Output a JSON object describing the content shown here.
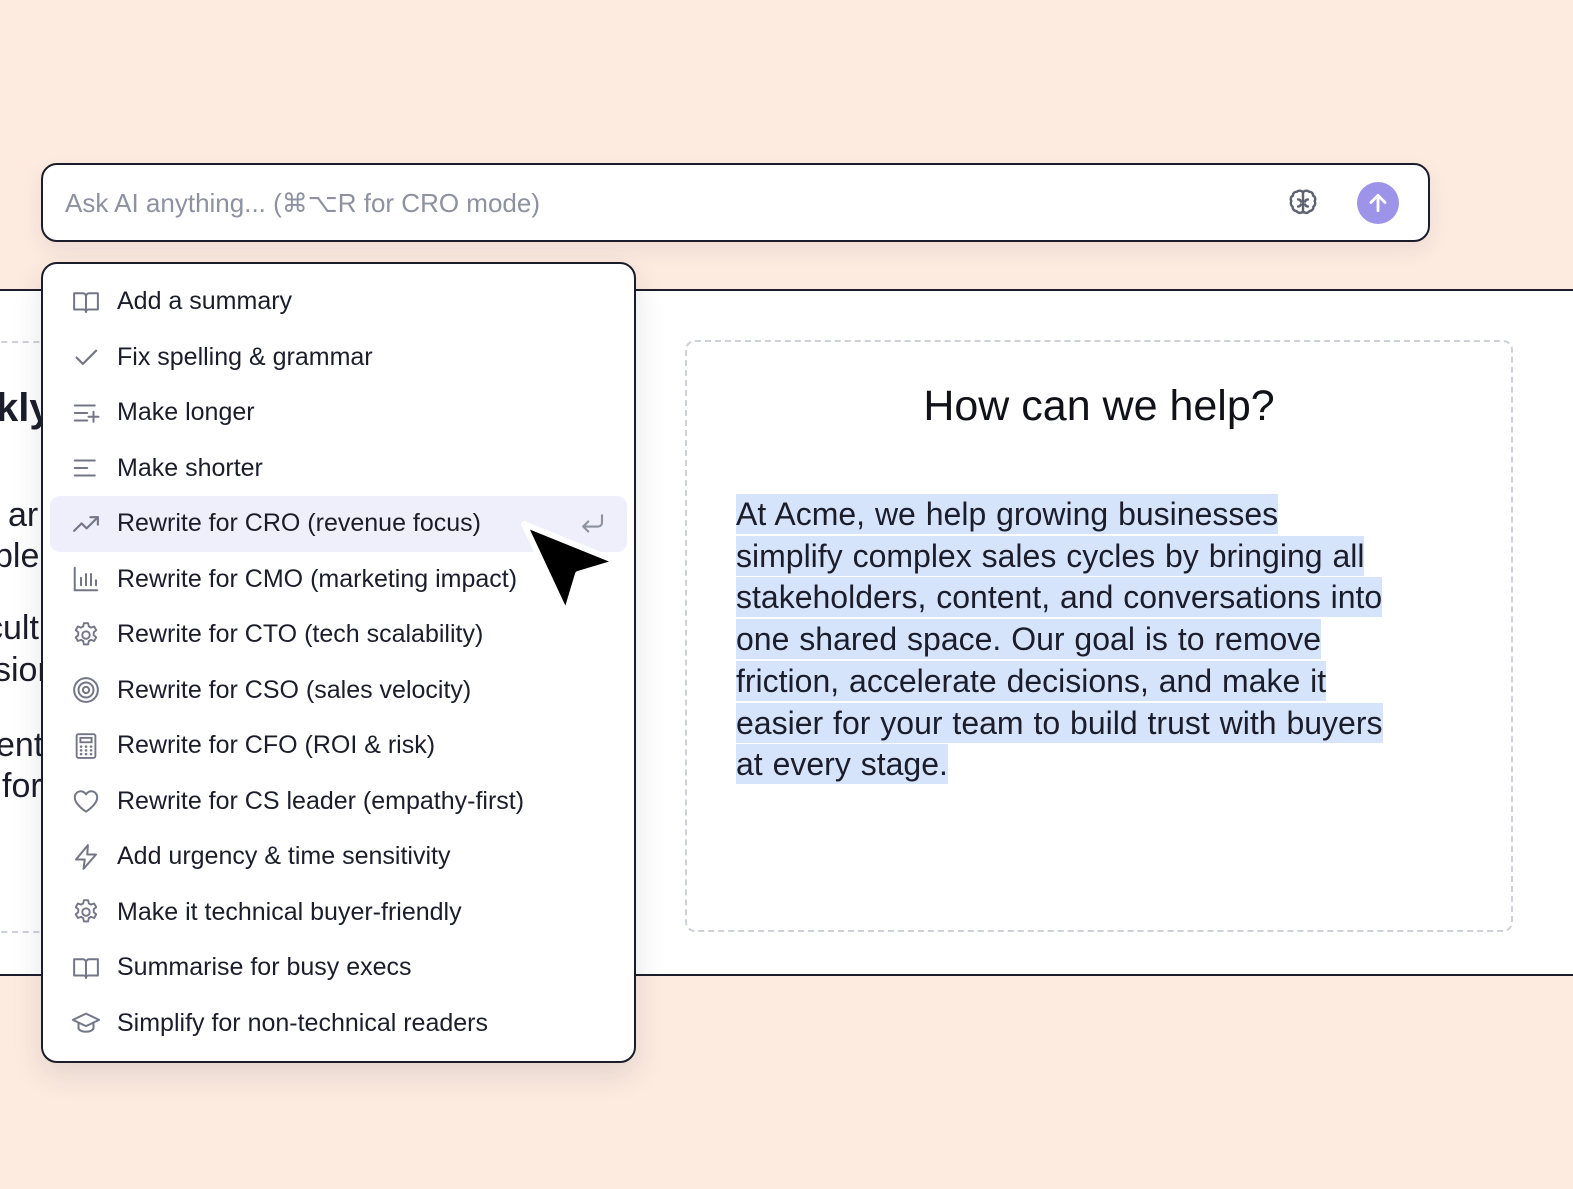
{
  "ai_bar": {
    "placeholder": "Ask AI anything... (⌘⌥R for CRO mode)",
    "brain_icon": "brain-icon",
    "send_icon": "arrow-up-icon",
    "send_color": "#9d93e8"
  },
  "menu": {
    "items": [
      {
        "label": "Add a summary",
        "icon": "book-open-icon"
      },
      {
        "label": "Fix spelling & grammar",
        "icon": "check-icon"
      },
      {
        "label": "Make longer",
        "icon": "lines-plus-icon"
      },
      {
        "label": "Make shorter",
        "icon": "lines-short-icon"
      },
      {
        "label": "Rewrite for CRO (revenue focus)",
        "icon": "trending-up-icon",
        "active": true
      },
      {
        "label": "Rewrite for CMO (marketing impact)",
        "icon": "bar-chart-icon"
      },
      {
        "label": "Rewrite for CTO (tech scalability)",
        "icon": "gear-icon"
      },
      {
        "label": "Rewrite for CSO (sales velocity)",
        "icon": "target-icon"
      },
      {
        "label": "Rewrite for CFO (ROI & risk)",
        "icon": "calculator-icon"
      },
      {
        "label": "Rewrite for CS leader (empathy-first)",
        "icon": "heart-icon"
      },
      {
        "label": "Add urgency & time sensitivity",
        "icon": "lightning-icon"
      },
      {
        "label": "Make it technical buyer-friendly",
        "icon": "gear-icon"
      },
      {
        "label": "Summarise for busy execs",
        "icon": "book-open-icon"
      },
      {
        "label": "Simplify for non-technical readers",
        "icon": "graduation-cap-icon"
      }
    ],
    "active_color": "#efeefb"
  },
  "page": {
    "left_fragments": [
      "kly",
      "ar",
      "ple",
      "cult",
      "sior",
      "ent",
      "for"
    ],
    "card_title": "How can we help?",
    "card_body_lines": [
      "At Acme, we help growing businesses",
      "simplify complex sales cycles by bringing all",
      "stakeholders, content, and conversations into",
      "one shared space. Our goal is to remove",
      "friction, accelerate decisions, and make it",
      "easier for your team to build trust with buyers",
      "at every stage."
    ],
    "highlight_color": "#d5e3fb"
  },
  "colors": {
    "background": "#fdebe0",
    "ink": "#1c1d2b",
    "muted": "#8e91a0"
  }
}
